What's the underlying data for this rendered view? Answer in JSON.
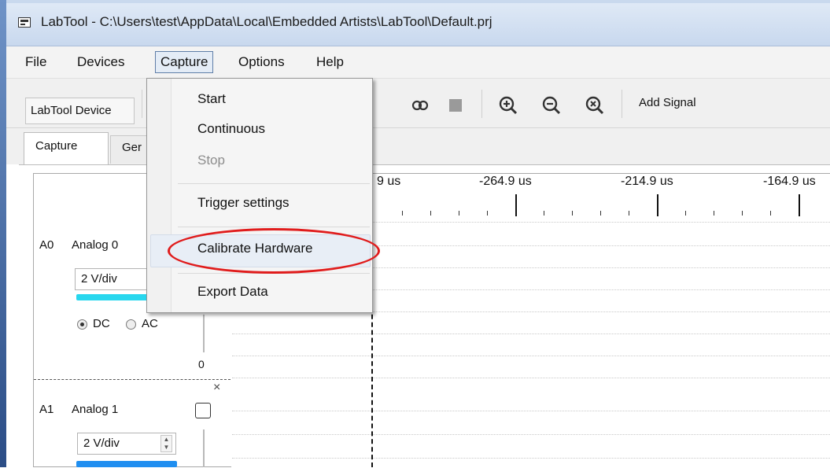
{
  "window": {
    "title": "LabTool - C:\\Users\\test\\AppData\\Local\\Embedded Artists\\LabTool\\Default.prj"
  },
  "menubar": {
    "items": [
      "File",
      "Devices",
      "Capture",
      "Options",
      "Help"
    ]
  },
  "toolbar": {
    "device_label": "LabTool Device",
    "icons": [
      "link-icon",
      "stop-icon",
      "zoom-in-icon",
      "zoom-out-icon",
      "zoom-fit-icon"
    ],
    "add_signal_label": "Add Signal"
  },
  "tabs": [
    "Capture",
    "Ger"
  ],
  "capture_menu": {
    "items": [
      {
        "label": "Start",
        "enabled": true
      },
      {
        "label": "Continuous",
        "enabled": true
      },
      {
        "label": "Stop",
        "enabled": false
      },
      {
        "label": "Trigger settings",
        "enabled": true
      },
      {
        "label": "Calibrate Hardware",
        "enabled": true,
        "highlighted": true
      },
      {
        "label": "Export Data",
        "enabled": true
      }
    ]
  },
  "timeline": {
    "ticks": [
      "9 us",
      "-264.9 us",
      "-214.9 us",
      "-164.9 us"
    ]
  },
  "channels": [
    {
      "id": "A0",
      "name": "Analog 0",
      "volts_per_div": "2 V/div",
      "color": "#28d7ee",
      "coupling": [
        "DC",
        "AC"
      ],
      "selected_coupling": "DC",
      "zero_label": "0"
    },
    {
      "id": "A1",
      "name": "Analog 1",
      "volts_per_div": "2 V/div",
      "color": "#1f8ef0",
      "remove_symbol": "×"
    }
  ]
}
